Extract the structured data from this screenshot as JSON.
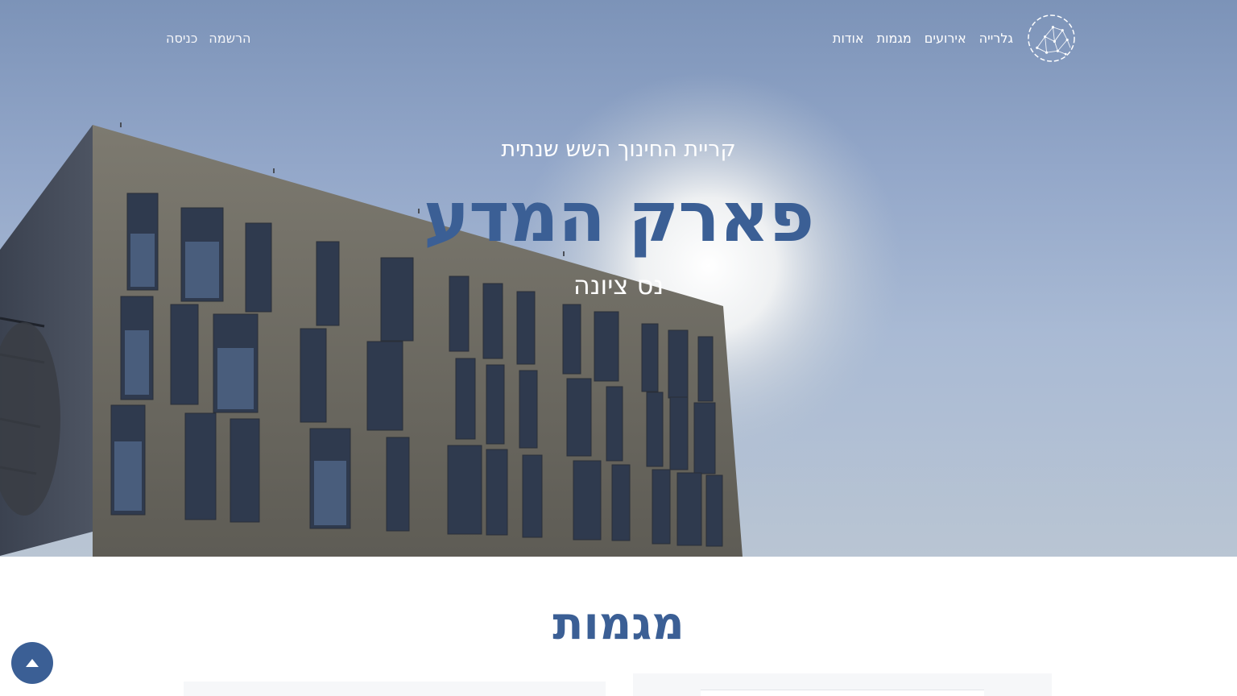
{
  "nav": {
    "logo_icon": "globe-network-icon",
    "links": [
      "אודות",
      "מגמות",
      "אירועים",
      "גלרייה"
    ],
    "auth": [
      "כניסה",
      "הרשמה"
    ]
  },
  "hero": {
    "subtitle": "קריית החינוך השש שנתית",
    "title": "פארק המדע",
    "city": "נס ציונה"
  },
  "section": {
    "title": "מגמות"
  },
  "scroll_top": {
    "icon": "arrow-up-icon"
  },
  "colors": {
    "accent": "#3b5f95",
    "sky": "#8ea3c6",
    "white": "#ffffff"
  }
}
